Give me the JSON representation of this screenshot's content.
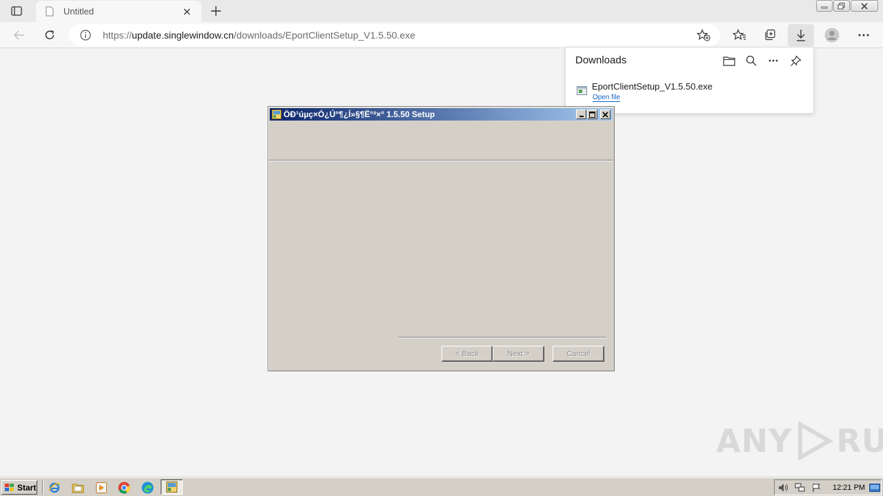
{
  "browser": {
    "tab": {
      "title": "Untitled"
    },
    "address": {
      "scheme": "https://",
      "host": "update.singlewindow.cn",
      "path": "/downloads/EportClientSetup_V1.5.50.exe"
    },
    "icons": [
      "tab-actions-icon",
      "page-icon",
      "close-icon",
      "plus-icon",
      "back-icon",
      "refresh-icon",
      "info-icon",
      "add-favorite-icon",
      "favorites-icon",
      "collections-icon",
      "download-icon",
      "profile-icon",
      "more-icon"
    ]
  },
  "downloads": {
    "title": "Downloads",
    "items": [
      {
        "filename": "EportClientSetup_V1.5.50.exe",
        "action": "Open file"
      }
    ]
  },
  "setup": {
    "title": "ÖÐ¹úµç×Ó¿Ú°¶¿Í»§¶Ë°²×° 1.5.50 Setup",
    "buttons": {
      "back": "< Back",
      "next": "Next >",
      "cancel": "Cancel"
    }
  },
  "watermark": {
    "left": "ANY",
    "right": "RUN"
  },
  "taskbar": {
    "start": "Start",
    "clock": "12:21 PM",
    "colors": {
      "titlebar_start": "#0a246a",
      "titlebar_end": "#a6caf0",
      "face": "#d4d0c8"
    }
  }
}
